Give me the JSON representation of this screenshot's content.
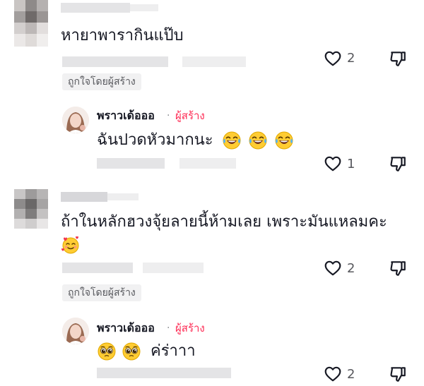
{
  "comments": [
    {
      "text": "หายาพารากินแป๊บ",
      "likes": "2",
      "liked_by_creator": "ถูกใจโดยผู้สร้าง"
    },
    {
      "text": "ถ้าในหลักฮวงจุ้ยลายนี้ห้ามเลย เพราะมันแหลมคะ",
      "likes": "2",
      "liked_by_creator": "ถูกใจโดยผู้สร้าง"
    }
  ],
  "replies": [
    {
      "author": "พราวเด้อออ",
      "separator": "·",
      "creator_label": "ผู้สร้าง",
      "text": "ฉันปวดหัวมากนะ",
      "likes": "1"
    },
    {
      "author": "พราวเด้อออ",
      "separator": "·",
      "creator_label": "ผู้สร้าง",
      "text": "ค่ร่าาา",
      "likes": "2"
    }
  ],
  "icons": {
    "like": "heart-outline-icon",
    "dislike": "thumbs-down-icon",
    "laugh": "tears-of-joy-emoji",
    "hearts_face": "smiling-face-with-hearts-emoji",
    "pleading": "pleading-face-emoji"
  },
  "colors": {
    "creator_accent": "#fe2c55",
    "text_primary": "#161823",
    "text_secondary": "#57585d",
    "badge_bg": "#f1f1f2"
  }
}
